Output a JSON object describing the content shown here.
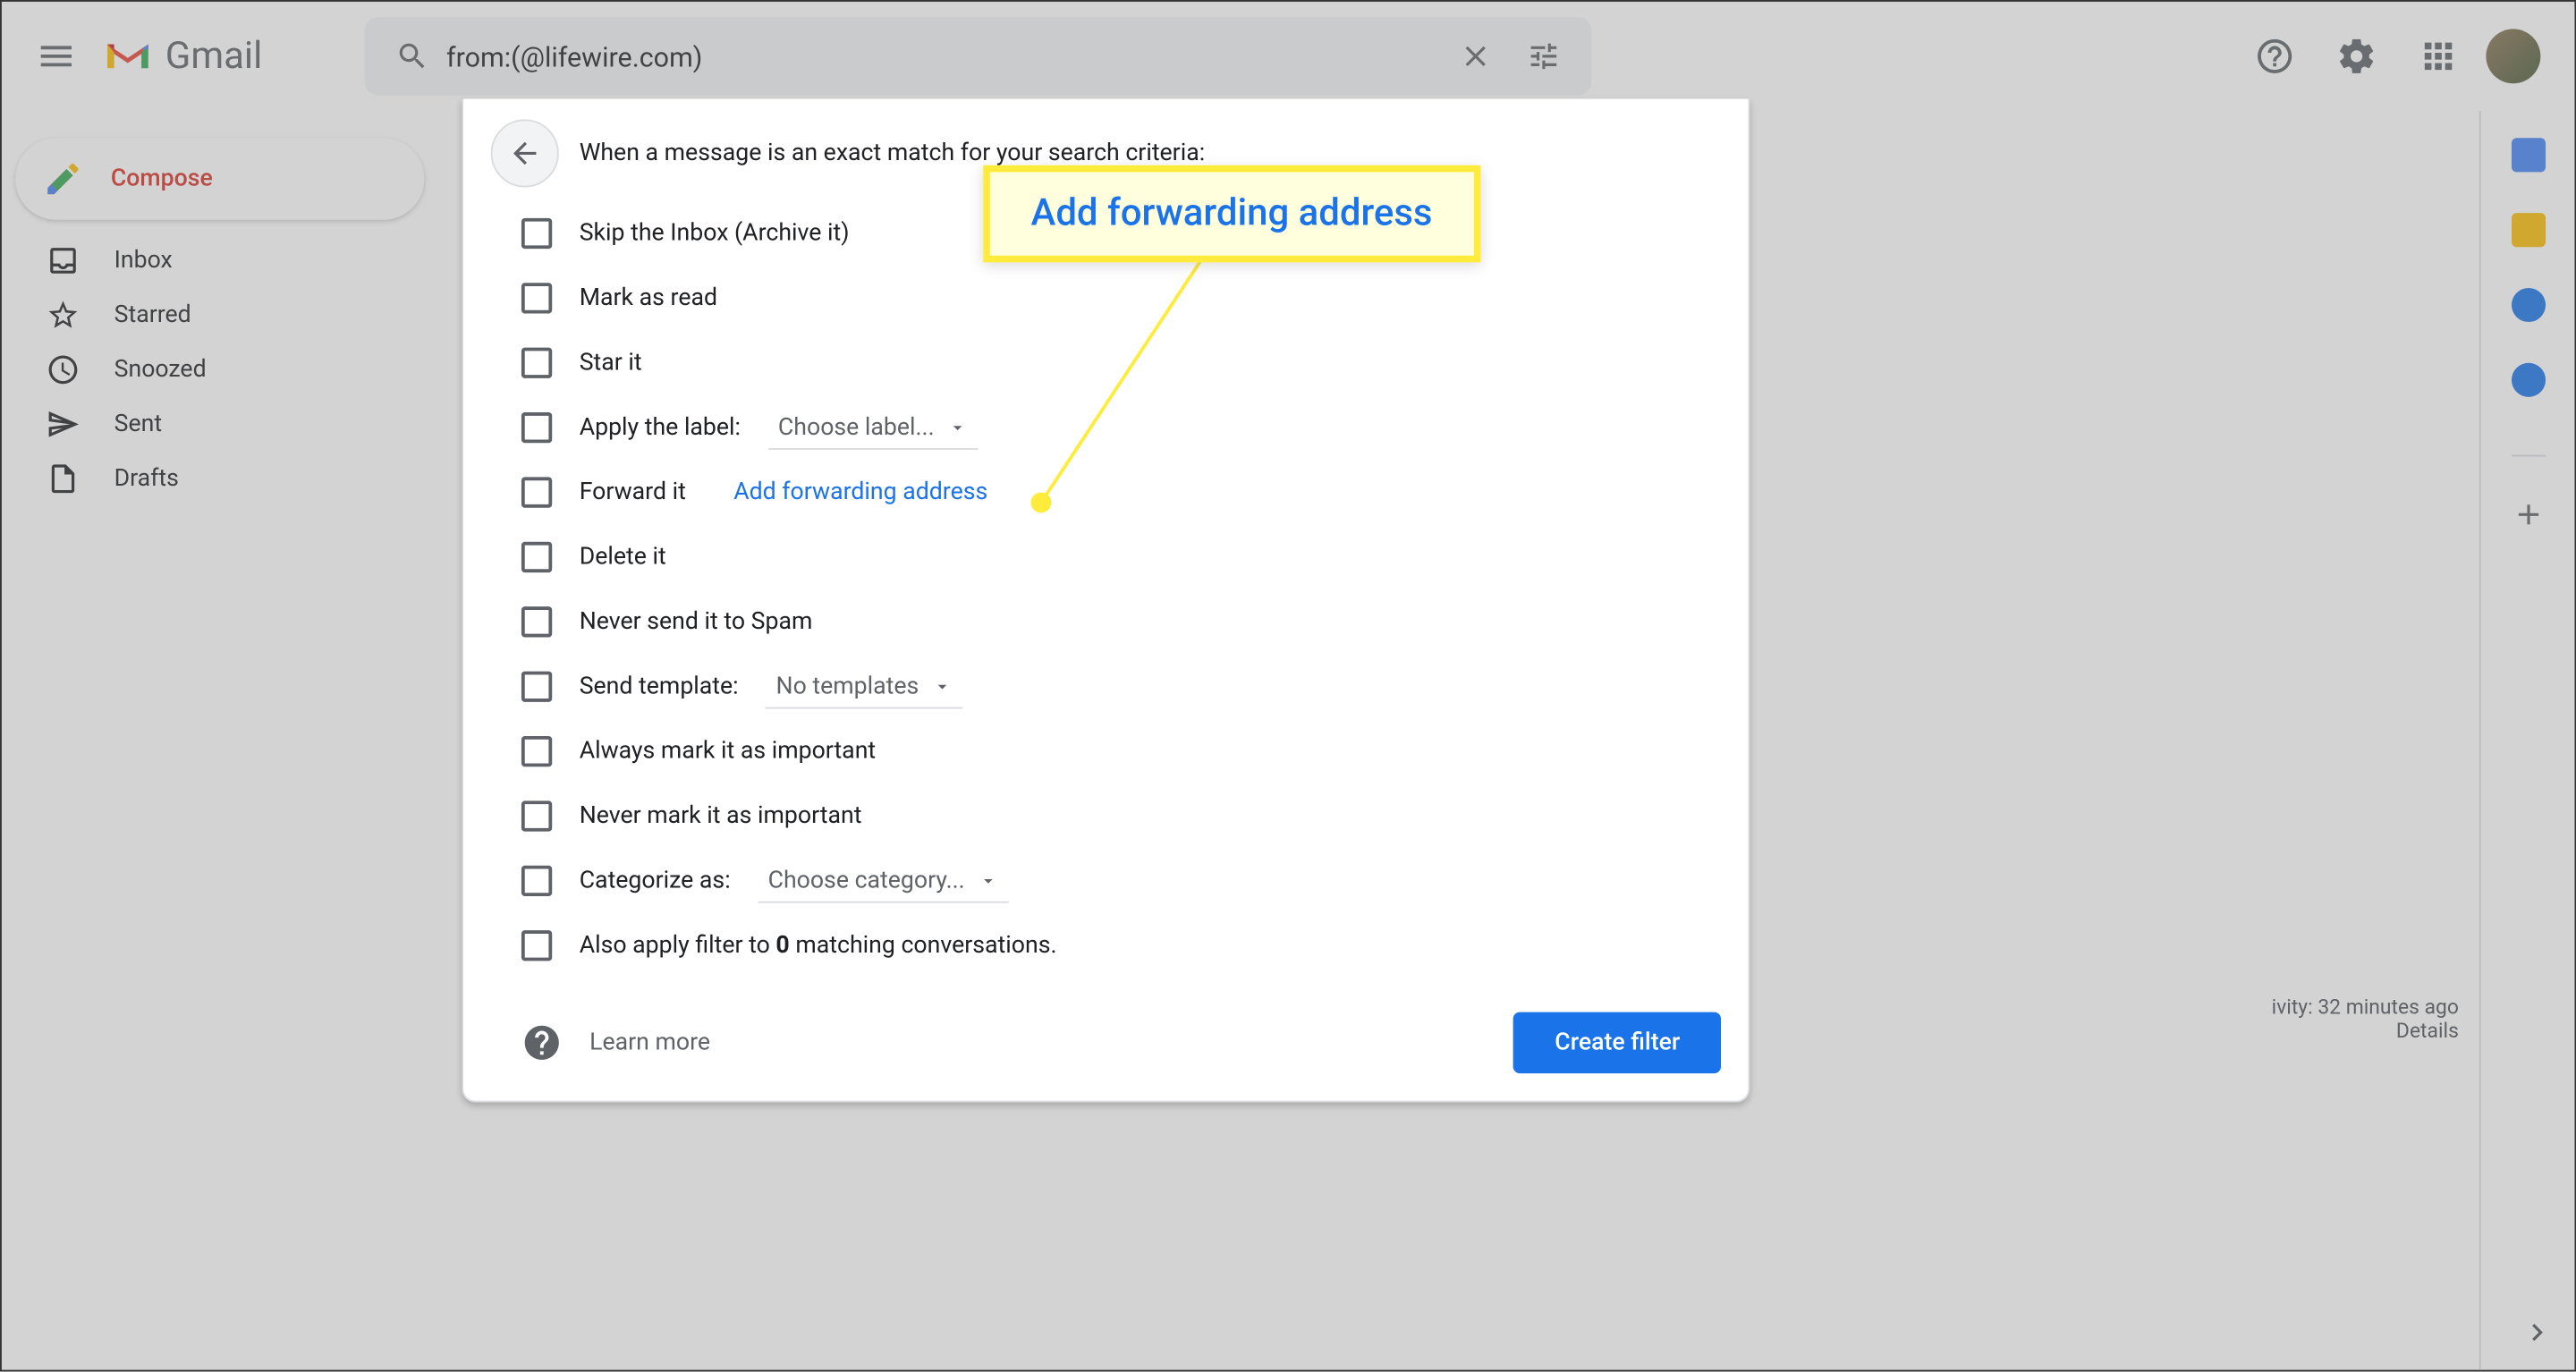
{
  "header": {
    "product_name": "Gmail",
    "search_value": "from:(@lifewire.com)"
  },
  "compose_label": "Compose",
  "sidebar": {
    "items": [
      {
        "label": "Inbox"
      },
      {
        "label": "Starred"
      },
      {
        "label": "Snoozed"
      },
      {
        "label": "Sent"
      },
      {
        "label": "Drafts"
      }
    ]
  },
  "filter_panel": {
    "title": "When a message is an exact match for your search criteria:",
    "rows": {
      "skip_inbox": "Skip the Inbox (Archive it)",
      "mark_read": "Mark as read",
      "star_it": "Star it",
      "apply_label": "Apply the label:",
      "apply_label_dropdown": "Choose label...",
      "forward_it": "Forward it",
      "forward_link": "Add forwarding address",
      "delete_it": "Delete it",
      "never_spam": "Never send it to Spam",
      "send_template": "Send template:",
      "send_template_dropdown": "No templates",
      "always_important": "Always mark it as important",
      "never_important": "Never mark it as important",
      "categorize": "Categorize as:",
      "categorize_dropdown": "Choose category...",
      "also_apply_prefix": "Also apply filter to ",
      "also_apply_count": "0",
      "also_apply_suffix": " matching conversations."
    },
    "learn_more": "Learn more",
    "create_filter": "Create filter"
  },
  "callout_text": "Add forwarding address",
  "activity": {
    "line1_partial": "ivity: 32 minutes ago",
    "details": "Details"
  }
}
